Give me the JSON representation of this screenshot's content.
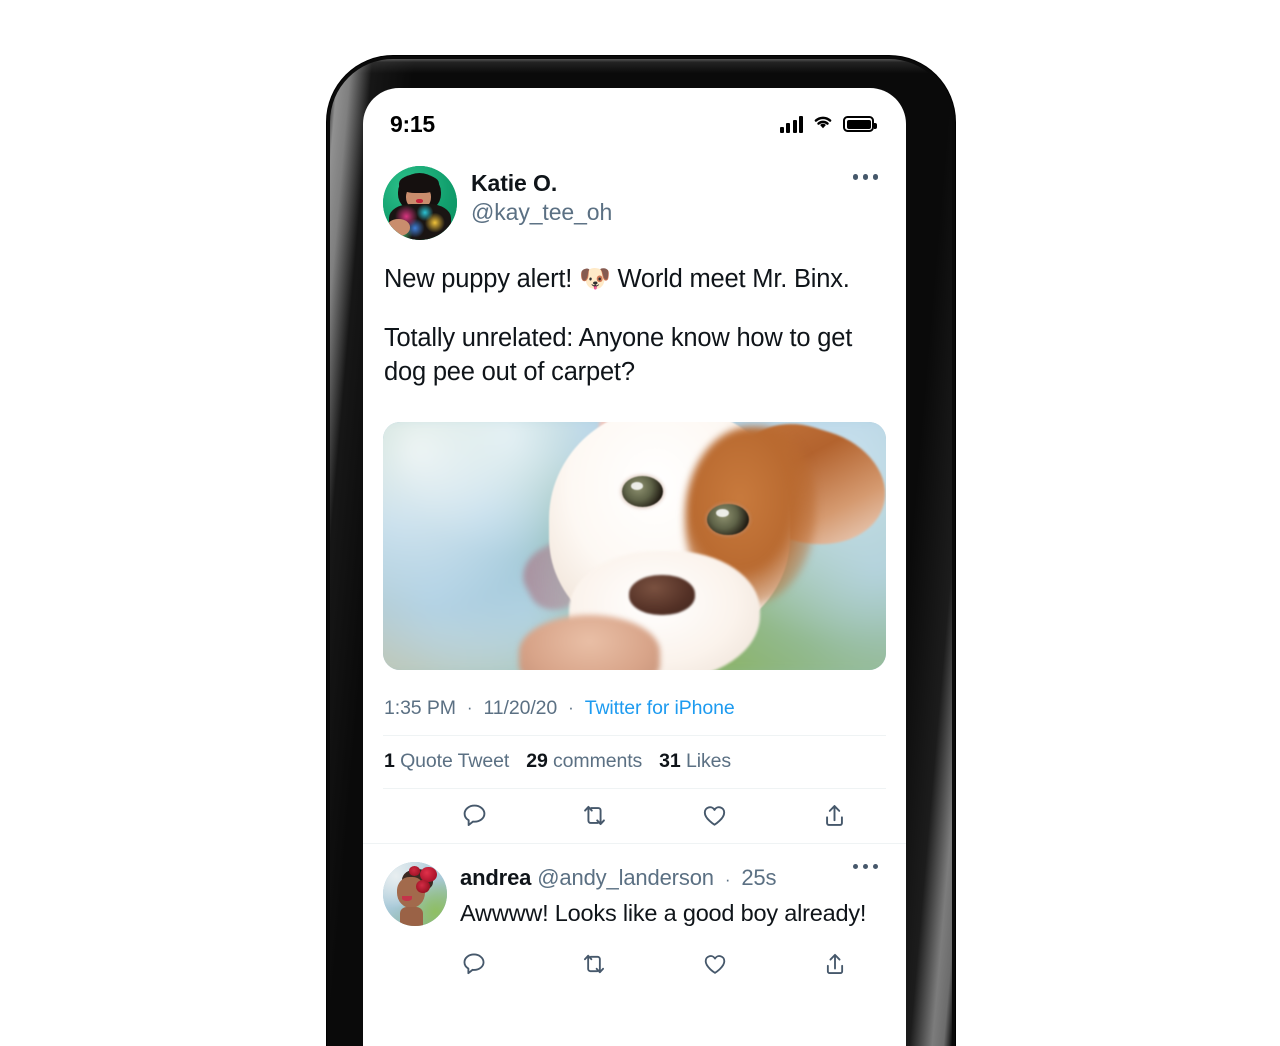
{
  "device": {
    "status_bar": {
      "time": "9:15",
      "signal_icon": "cellular-signal-icon",
      "signal_bars": 4,
      "wifi_icon": "wifi-icon",
      "battery_icon": "battery-full-icon",
      "battery_level": 100
    }
  },
  "tweet": {
    "author": {
      "display_name": "Katie O.",
      "handle": "@kay_tee_oh",
      "avatar_name": "katie-avatar"
    },
    "more_menu_label": "more-options",
    "body": {
      "line1_before_emoji": "New puppy alert! ",
      "emoji": "🐶",
      "line1_after_emoji": " World meet Mr. Binx.",
      "paragraph2": "Totally unrelated: Anyone know how to get dog pee out of carpet?"
    },
    "media": {
      "alt": "puppy-photo",
      "description": "Close-up of a white and brown puppy held up against blurred green and blue foliage"
    },
    "meta": {
      "time": "1:35 PM",
      "separator": "·",
      "date": "11/20/20",
      "source": "Twitter for iPhone"
    },
    "stats": {
      "quote_tweets_count": "1",
      "quote_tweets_label": "Quote Tweet",
      "comments_count": "29",
      "comments_label": "comments",
      "likes_count": "31",
      "likes_label": "Likes"
    },
    "actions": [
      {
        "name": "reply-icon",
        "label": "Reply"
      },
      {
        "name": "retweet-icon",
        "label": "Retweet"
      },
      {
        "name": "like-icon",
        "label": "Like"
      },
      {
        "name": "share-icon",
        "label": "Share"
      }
    ]
  },
  "reply": {
    "author": {
      "display_name": "andrea",
      "handle": "@andy_landerson",
      "avatar_name": "andrea-avatar"
    },
    "separator": "·",
    "timestamp": "25s",
    "text": "Awwww! Looks like a good boy already!",
    "more_menu_label": "more-options",
    "actions": [
      {
        "name": "reply-icon",
        "label": "Reply"
      },
      {
        "name": "retweet-icon",
        "label": "Retweet"
      },
      {
        "name": "like-icon",
        "label": "Like"
      },
      {
        "name": "share-icon",
        "label": "Share"
      }
    ]
  },
  "colors": {
    "accent_link": "#1D9BF0",
    "text_primary": "#0F1419",
    "text_secondary": "#5B7083",
    "icon_stroke": "#46586B",
    "divider": "#EFF3F4",
    "page_background": "#FFFFFF",
    "device_frame": "#0A0A0A"
  }
}
